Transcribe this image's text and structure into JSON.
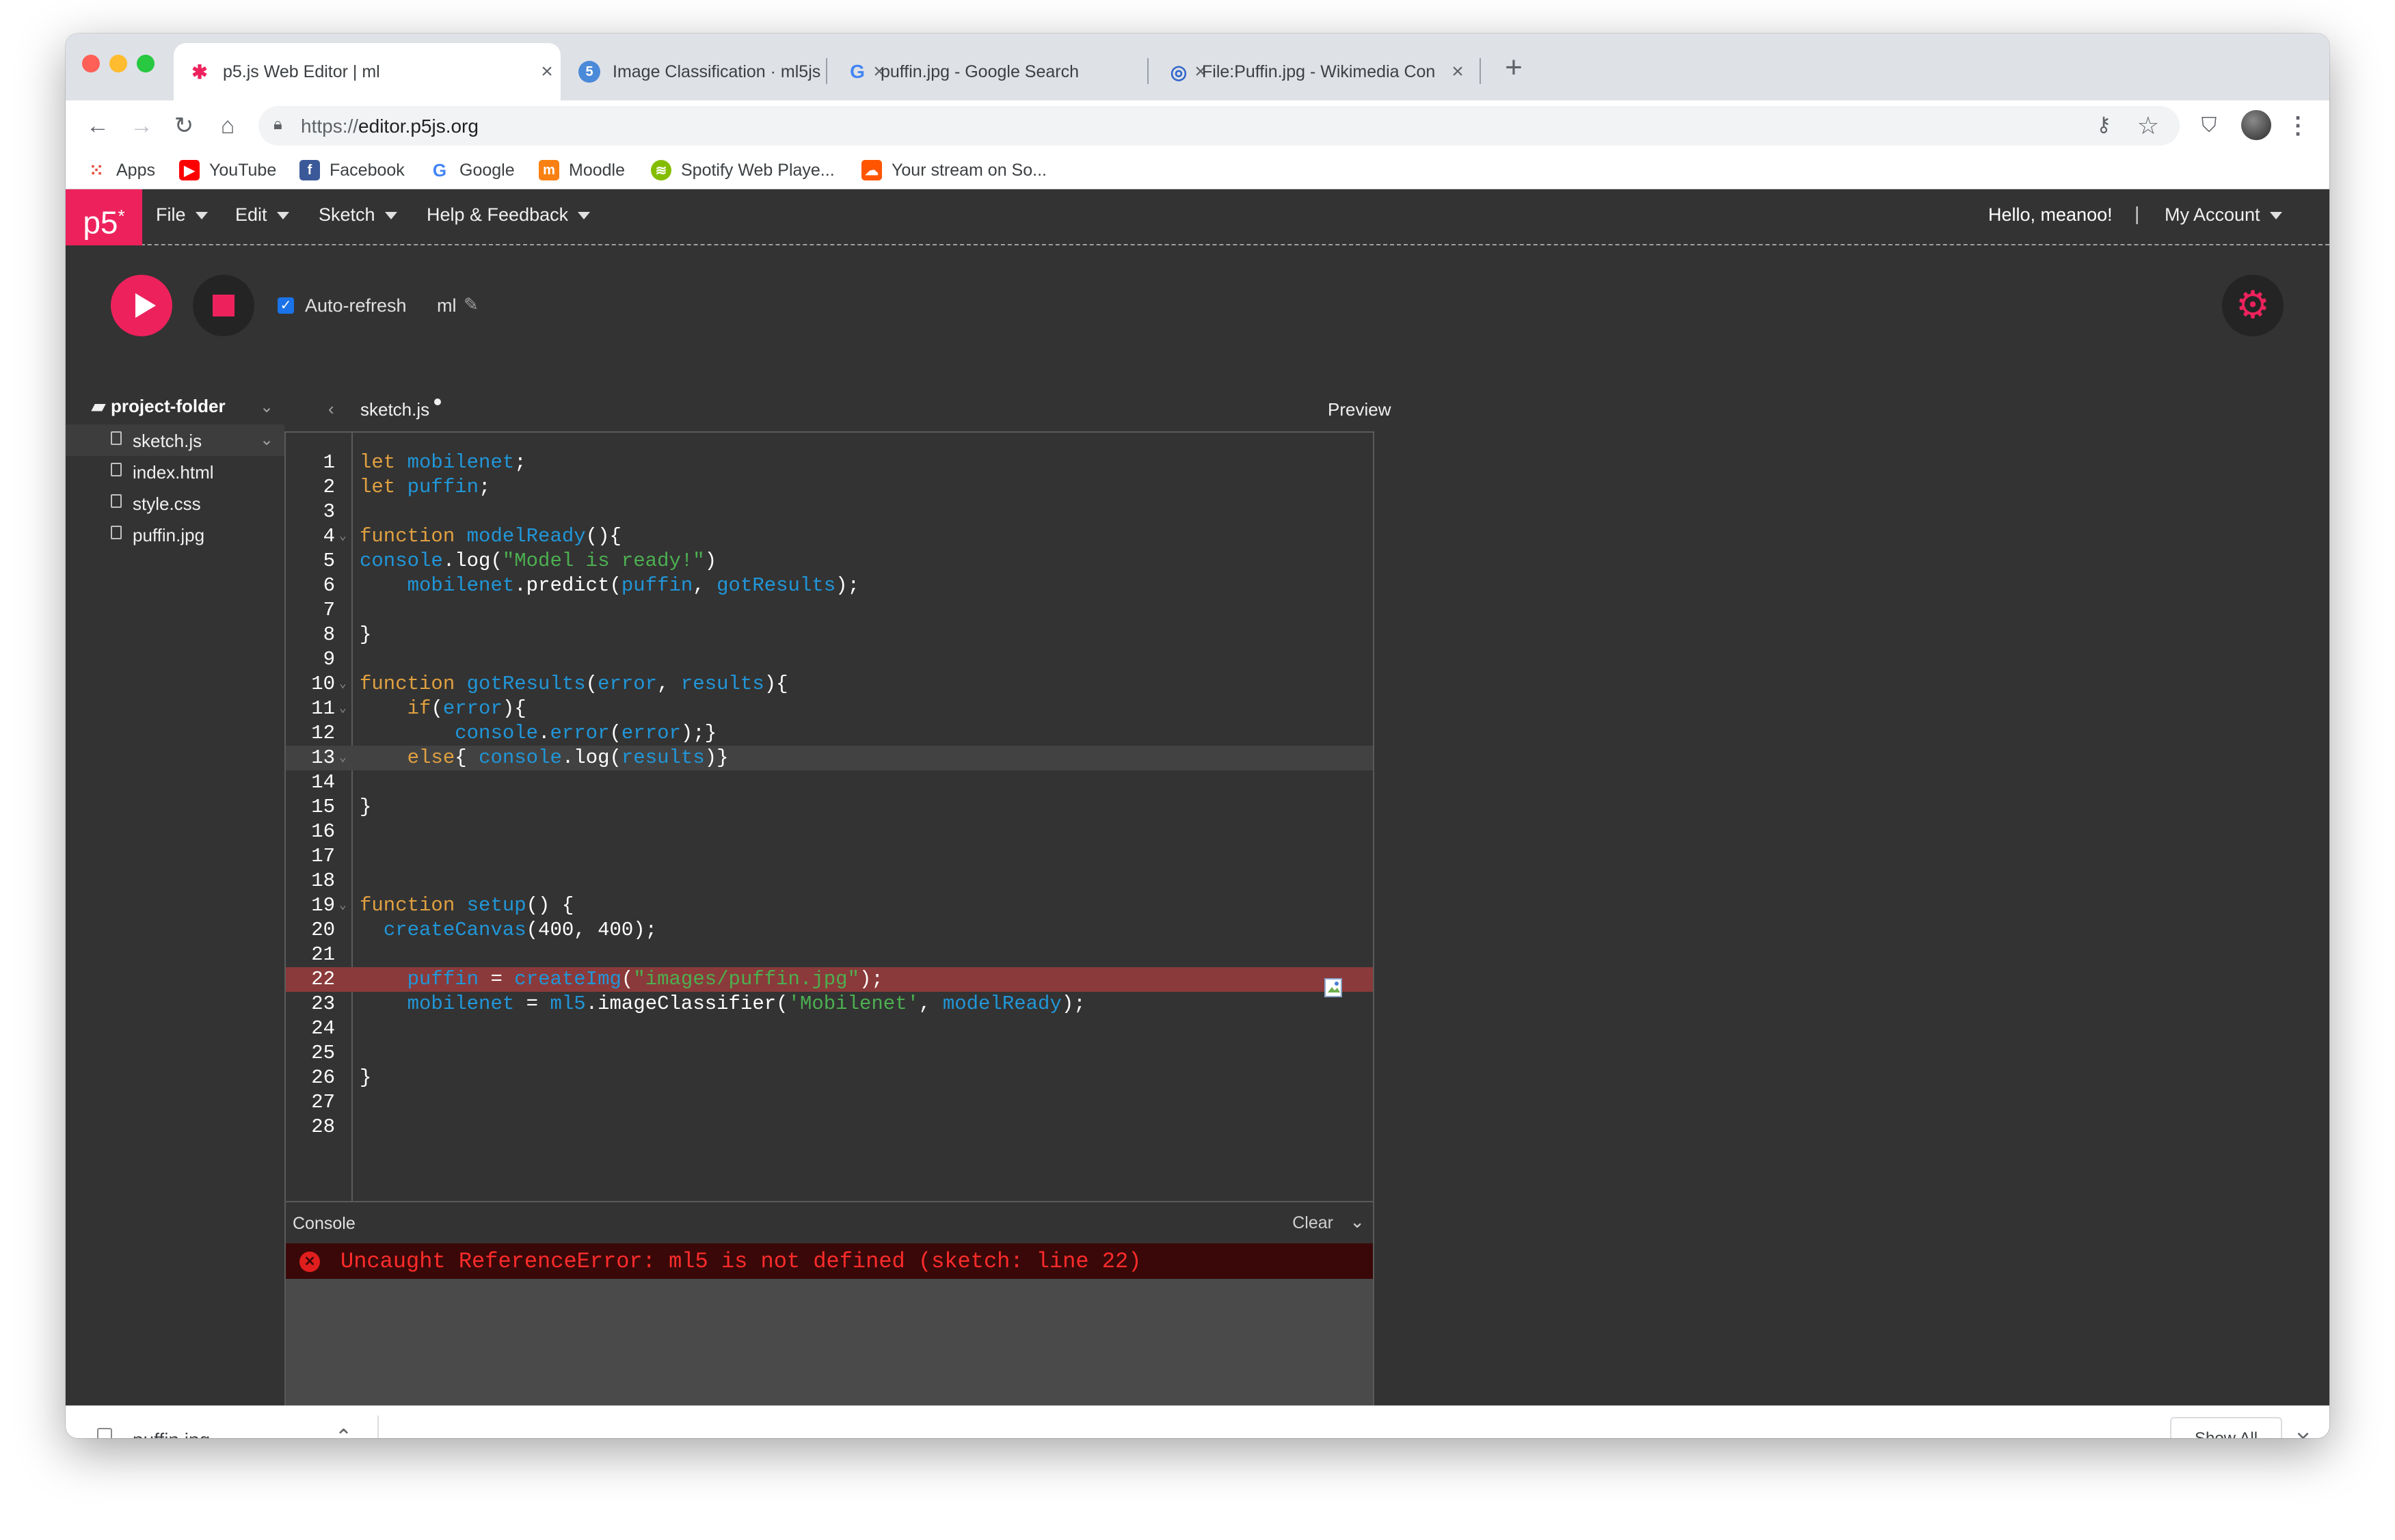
{
  "browser": {
    "tabs": [
      {
        "title": "p5.js Web Editor | ml",
        "icon": "p5-asterisk-icon"
      },
      {
        "title": "Image Classification · ml5js",
        "icon": "ml5-icon"
      },
      {
        "title": "puffin.jpg - Google Search",
        "icon": "google-icon"
      },
      {
        "title": "File:Puffin.jpg - Wikimedia Con",
        "icon": "wikimedia-icon"
      }
    ],
    "new_tab": "+",
    "close_glyph": "×",
    "url_protocol": "https://",
    "url_host": "editor.p5js.org"
  },
  "bookmarks": [
    {
      "label": "Apps",
      "color": "#e8453c"
    },
    {
      "label": "YouTube",
      "color": "#ff0000"
    },
    {
      "label": "Facebook",
      "color": "#3b5998"
    },
    {
      "label": "Google",
      "color": "#4285f4"
    },
    {
      "label": "Moodle",
      "color": "#f98012"
    },
    {
      "label": "Spotify Web Playe...",
      "color": "#84bd00"
    },
    {
      "label": "Your stream on So...",
      "color": "#ff5500"
    }
  ],
  "p5": {
    "logo": "p5",
    "logo_sup": "*",
    "menu": [
      "File",
      "Edit",
      "Sketch",
      "Help & Feedback"
    ],
    "greeting": "Hello, meanoo!",
    "separator": "|",
    "account": "My Account",
    "auto_refresh_label": "Auto-refresh",
    "sketch_name": "ml",
    "project_folder": "project-folder",
    "files": [
      "sketch.js",
      "index.html",
      "style.css",
      "puffin.jpg"
    ],
    "editor_tab": "sketch.js",
    "preview_label": "Preview",
    "accent_color": "#ed225d"
  },
  "code_lines": [
    "let mobilenet;",
    "let puffin;",
    "",
    "function modelReady(){",
    "console.log(\"Model is ready!\")",
    "    mobilenet.predict(puffin, gotResults);",
    "",
    "}",
    "",
    "function gotResults(error, results){",
    "    if(error){",
    "        console.error(error);}",
    "    else{ console.log(results)}",
    "",
    "}",
    "",
    "",
    "",
    "function setup() {",
    "  createCanvas(400, 400);",
    "",
    "    puffin = createImg(\"images/puffin.jpg\");",
    "    mobilenet = ml5.imageClassifier('Mobilenet', modelReady);",
    "",
    "",
    "}",
    "",
    ""
  ],
  "console": {
    "title": "Console",
    "clear": "Clear",
    "error": "Uncaught ReferenceError: ml5 is not defined (sketch: line 22)"
  },
  "downloads": {
    "file": "puffin.jpg",
    "show_all": "Show All"
  }
}
